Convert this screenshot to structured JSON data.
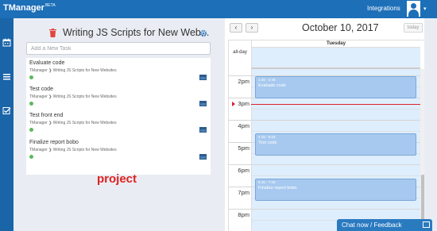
{
  "app": {
    "brand": "TManager",
    "brand_badge": "BETA",
    "integrations_label": "Integrations"
  },
  "colors": {
    "topbar": "#1d6fb8",
    "rail": "#1a64a8",
    "event": "#a7c9ef",
    "now_line": "#d9232d",
    "done_dot": "#5cb85c",
    "project_label": "#e02020"
  },
  "icons": {
    "rail": [
      "calendar-icon",
      "list-icon",
      "checkbox-icon"
    ],
    "header": [
      "trash-icon",
      "gear-icon",
      "avatar-icon",
      "caret-down-icon"
    ],
    "task": [
      "status-dot-icon",
      "calendar-small-icon"
    ],
    "chat": "chat-window-icon"
  },
  "project": {
    "title": "Writing JS Scripts for New Web...",
    "add_placeholder": "Add a New Task",
    "annotation": "project"
  },
  "tasks": [
    {
      "title": "Evaluate code",
      "path": "TManager ❯ Writing JS Scripts for New Websites"
    },
    {
      "title": "Test code",
      "path": "TManager ❯ Writing JS Scripts for New Websites"
    },
    {
      "title": "Test front end",
      "path": "TManager ❯ Writing JS Scripts for New Websites"
    },
    {
      "title": "Finalize report bobo",
      "path": "TManager ❯ Writing JS Scripts for New Websites"
    }
  ],
  "calendar": {
    "date_title": "October 10, 2017",
    "prev_label": "‹",
    "next_label": "›",
    "today_label": "today",
    "day_header": "Tuesday",
    "allday_label": "all-day",
    "hours": [
      "2pm",
      "3pm",
      "4pm",
      "5pm",
      "6pm",
      "7pm",
      "8pm"
    ],
    "events": [
      {
        "time": "1:45 - 2:45",
        "title": "Evaluate code"
      },
      {
        "time": "4:15 - 5:15",
        "title": "Test code"
      },
      {
        "time": "6:15 - 7:15",
        "title": "Finalize report bobo"
      }
    ]
  },
  "chat": {
    "label": "Chat now / Feedback"
  }
}
